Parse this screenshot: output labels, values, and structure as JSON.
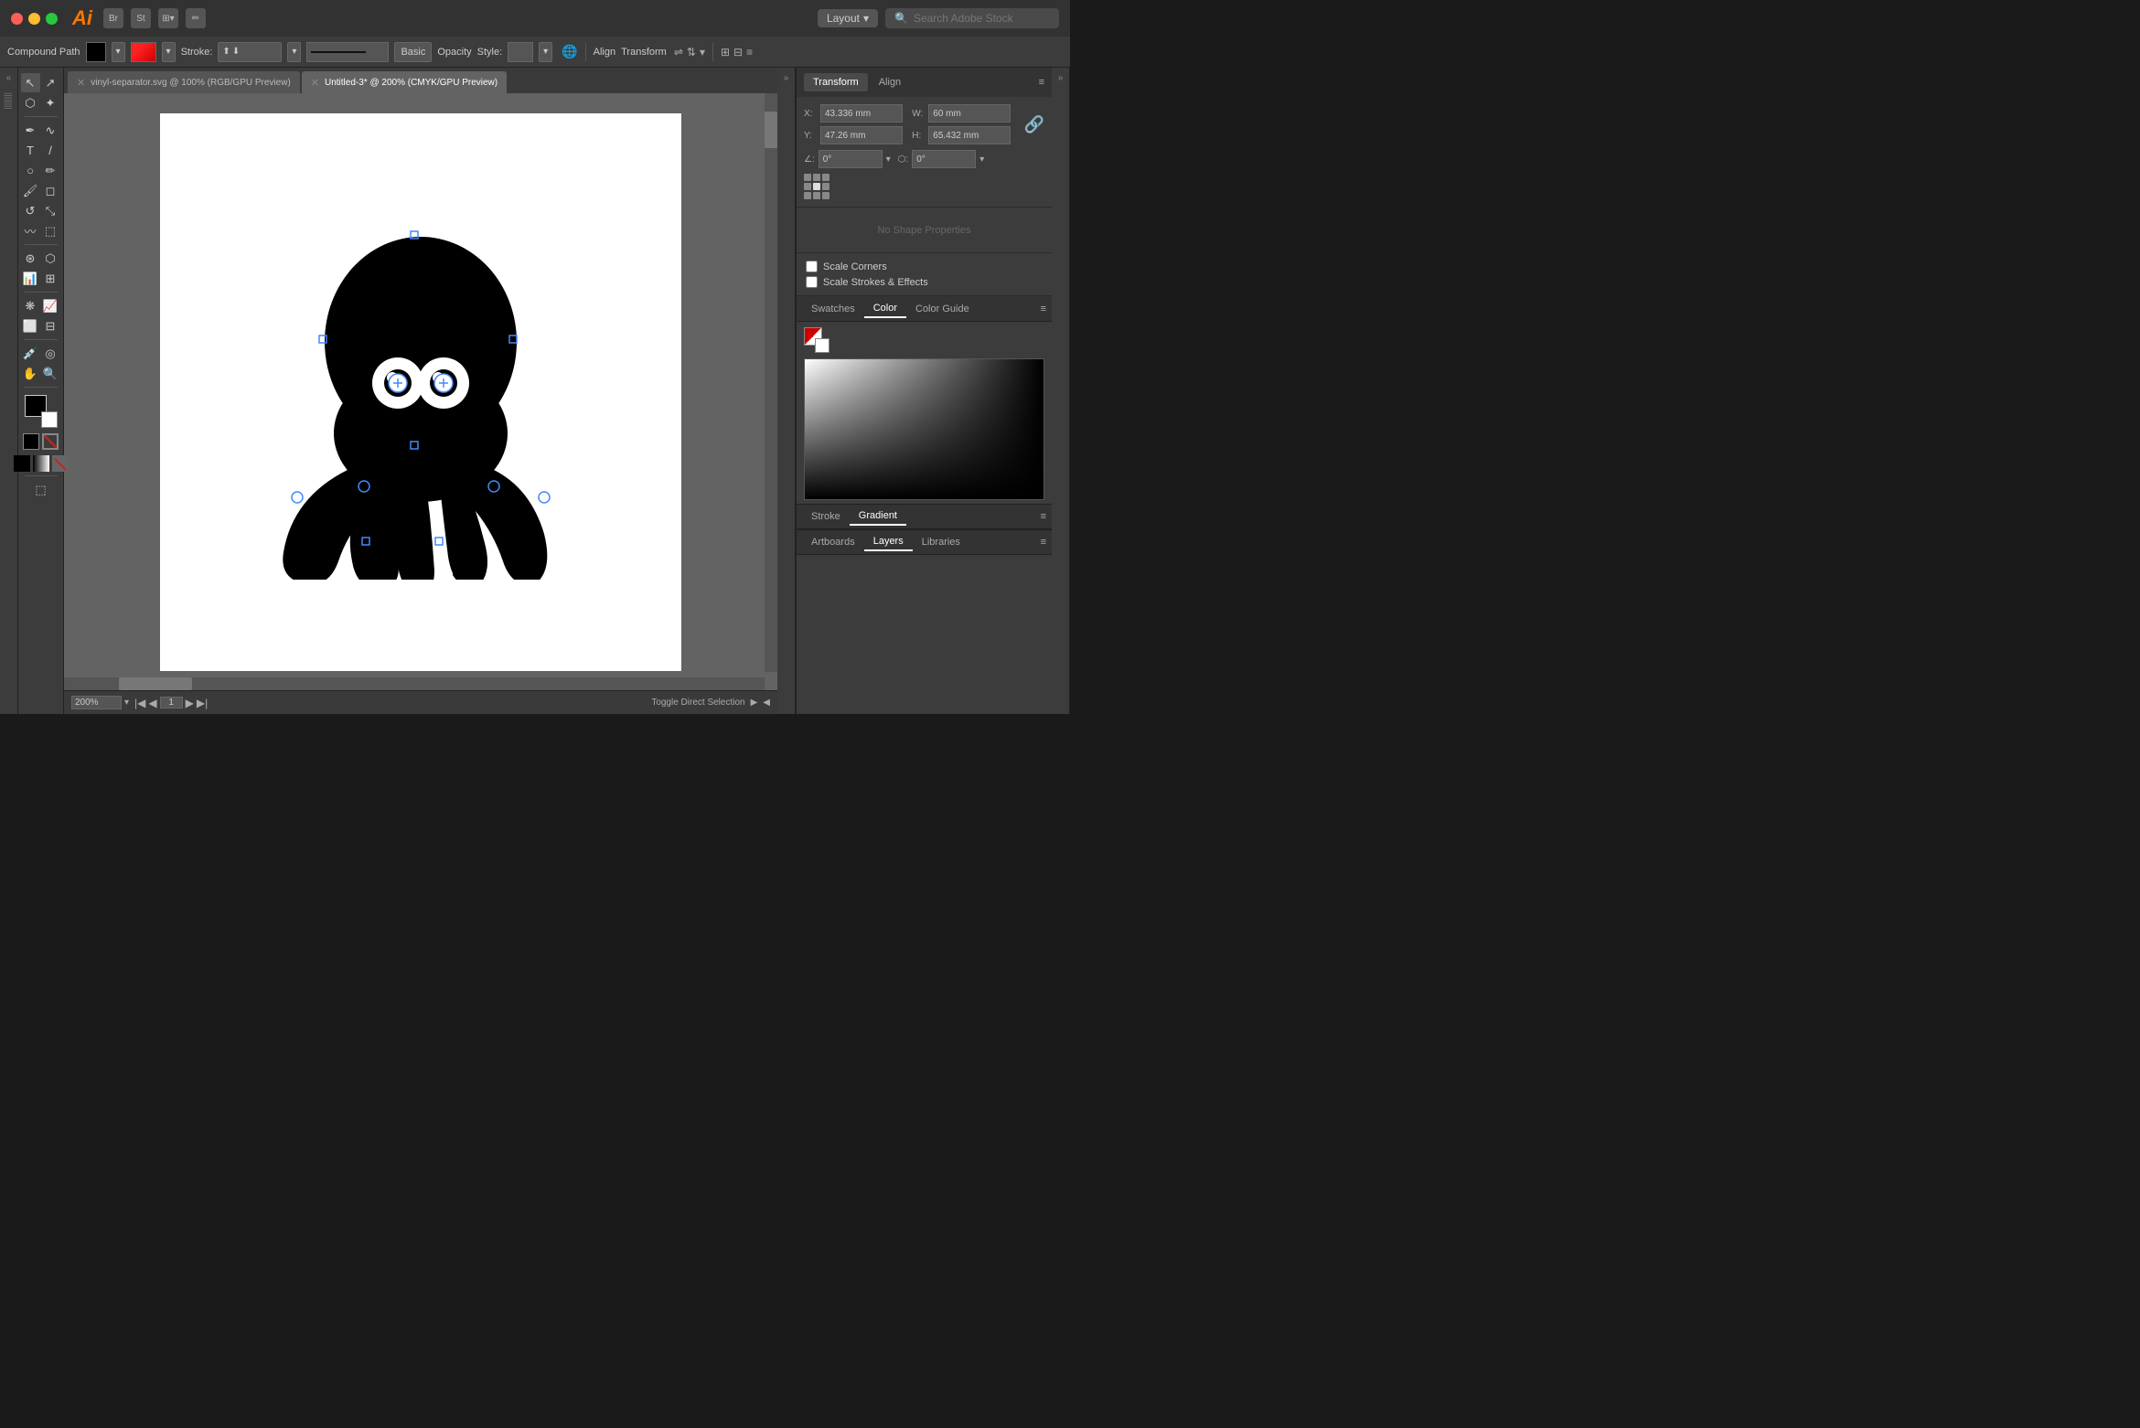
{
  "titlebar": {
    "app_name": "Ai",
    "layout_label": "Layout",
    "search_placeholder": "Search Adobe Stock"
  },
  "optionsbar": {
    "compound_path_label": "Compound Path",
    "stroke_label": "Stroke:",
    "stroke_value": "",
    "opacity_label": "Opacity",
    "style_label": "Style:",
    "basic_label": "Basic",
    "align_label": "Align",
    "transform_label": "Transform"
  },
  "tabs": [
    {
      "label": "vinyl-separator.svg @ 100% (RGB/GPU Preview)",
      "active": false
    },
    {
      "label": "Untitled-3* @ 200% (CMYK/GPU Preview)",
      "active": true
    }
  ],
  "zoom": "200%",
  "page": "1",
  "bottom_label": "Toggle Direct Selection",
  "transform_panel": {
    "tab_transform": "Transform",
    "tab_align": "Align",
    "x_label": "X:",
    "x_value": "43.336 mm",
    "w_label": "W:",
    "w_value": "60 mm",
    "y_label": "Y:",
    "y_value": "47.26 mm",
    "h_label": "H:",
    "h_value": "65.432 mm",
    "angle1_label": "∠:",
    "angle1_value": "0°",
    "angle2_label": "⬡:",
    "angle2_value": "0°",
    "no_shape_props": "No Shape Properties"
  },
  "checkboxes": {
    "scale_corners": "Scale Corners",
    "scale_strokes": "Scale Strokes & Effects"
  },
  "color_panel": {
    "tab_swatches": "Swatches",
    "tab_color": "Color",
    "tab_color_guide": "Color Guide"
  },
  "gradient_panel": {
    "tab_stroke": "Stroke",
    "tab_gradient": "Gradient"
  },
  "bottom_panels": {
    "tab_artboards": "Artboards",
    "tab_layers": "Layers",
    "tab_libraries": "Libraries"
  }
}
